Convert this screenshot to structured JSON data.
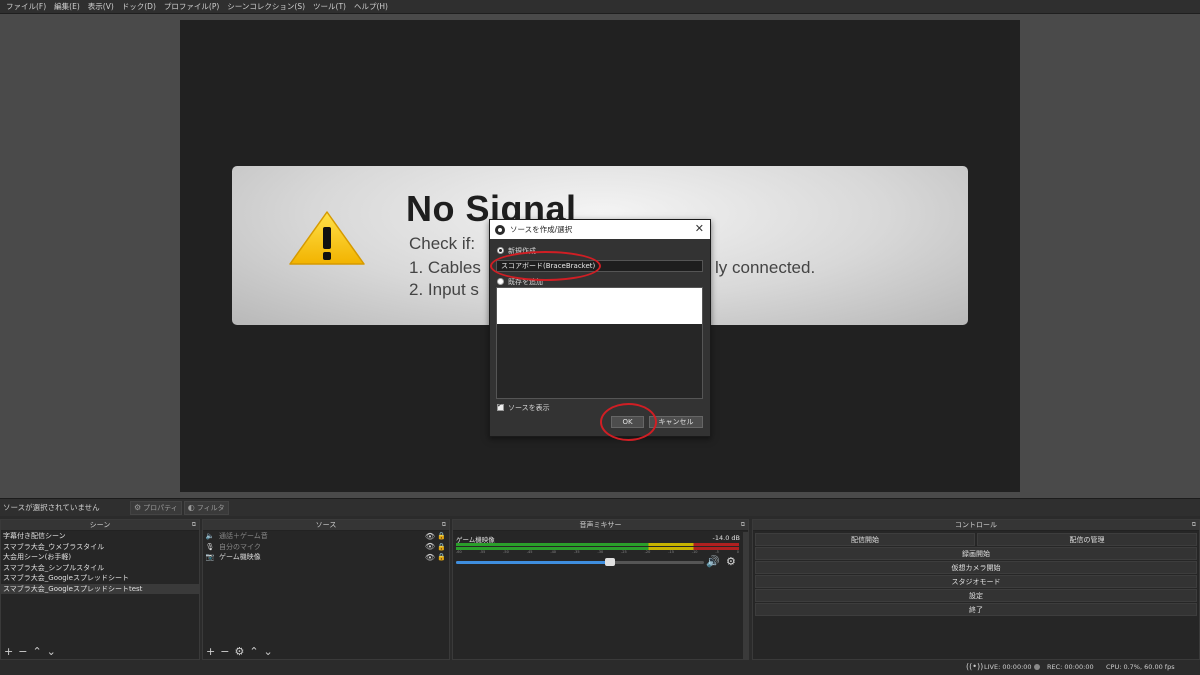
{
  "menu": [
    "ファイル(F)",
    "編集(E)",
    "表示(V)",
    "ドック(D)",
    "プロファイル(P)",
    "シーンコレクション(S)",
    "ツール(T)",
    "ヘルプ(H)"
  ],
  "preview": {
    "title": "No Signal",
    "line1": "Check if:",
    "line2a": "1. Cables",
    "line2b": "ly connected.",
    "line3": "2. Input s"
  },
  "dialog": {
    "title": "ソースを作成/選択",
    "close": "✕",
    "create_new": "新規作成",
    "name_value": "スコアボード(BraceBracket)",
    "add_existing": "既存を追加",
    "show_source": "ソースを表示",
    "ok": "OK",
    "cancel": "キャンセル"
  },
  "toolbar": {
    "no_source": "ソースが選択されていません",
    "properties": "プロパティ",
    "filters": "フィルタ"
  },
  "scenes": {
    "header": "シーン",
    "items": [
      "字幕付き配信シーン",
      "スマブラ大会_ウメブラスタイル",
      "大会用シーン(お手軽)",
      "スマブラ大会_シンプルスタイル",
      "スマブラ大会_Googleスプレッドシート",
      "スマブラ大会_Googleスプレッドシートtest"
    ],
    "selected": 5
  },
  "sources": {
    "header": "ソース",
    "items": [
      {
        "name": "通話＋ゲーム音",
        "icon": "speaker-icon",
        "dim": true
      },
      {
        "name": "自分のマイク",
        "icon": "mic-icon",
        "dim": true
      },
      {
        "name": "ゲーム機映像",
        "icon": "camera-icon",
        "dim": false
      }
    ]
  },
  "mixer": {
    "header": "音声ミキサー",
    "channel": "ゲーム機映像",
    "db": "-14.0 dB",
    "ticks": [
      "-60",
      "-55",
      "-50",
      "-45",
      "-40",
      "-35",
      "-30",
      "-25",
      "-20",
      "-15",
      "-10",
      "-5",
      "0"
    ],
    "volume_fraction": 0.62
  },
  "controls": {
    "header": "コントロール",
    "start_stream": "配信開始",
    "manage_stream": "配信の管理",
    "start_record": "録画開始",
    "virtual_cam": "仮想カメラ開始",
    "studio_mode": "スタジオモード",
    "settings": "設定",
    "exit": "終了"
  },
  "status": {
    "live": "LIVE: 00:00:00",
    "rec": "REC: 00:00:00",
    "cpu": "CPU: 0.7%, 60.00 fps"
  },
  "colors": {
    "accent_red": "#d01e24",
    "slider_blue": "#3f8ede",
    "meter_green": "#2aa02a",
    "meter_yellow": "#c8b400",
    "meter_red": "#b02020"
  }
}
